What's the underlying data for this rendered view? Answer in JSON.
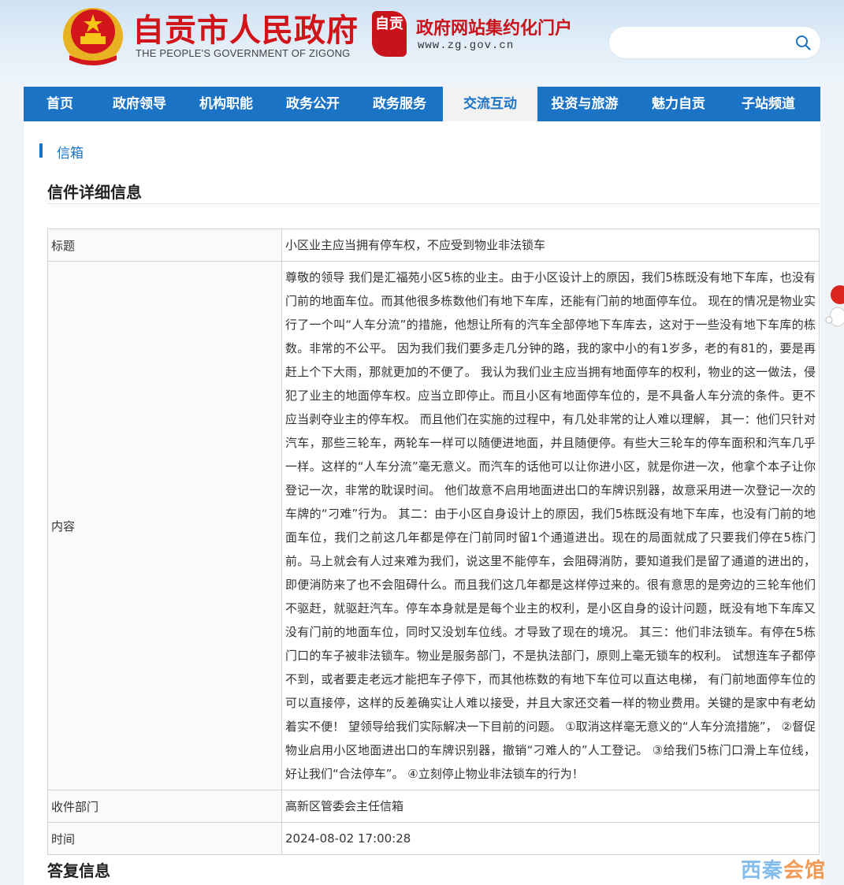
{
  "header": {
    "site_title": "自贡市人民政府",
    "site_subtitle": "THE PEOPLE'S GOVERNMENT OF ZIGONG",
    "portal_logo_text": "自贡",
    "portal_title": "政府网站集约化门户",
    "portal_url": "www.zg.gov.cn",
    "search_placeholder": ""
  },
  "nav": {
    "items": [
      {
        "label": "首页",
        "width": 92
      },
      {
        "label": "政府领导",
        "width": 110
      },
      {
        "label": "机构职能",
        "width": 110
      },
      {
        "label": "政务公开",
        "width": 110
      },
      {
        "label": "政务服务",
        "width": 110
      },
      {
        "label": "交流互动",
        "width": 120,
        "active": true
      },
      {
        "label": "投资与旅游",
        "width": 120
      },
      {
        "label": "魅力自贡",
        "width": 118
      },
      {
        "label": "子站频道",
        "width": 110
      }
    ]
  },
  "breadcrumb": "信箱",
  "section_title": "信件详细信息",
  "letter": {
    "title_label": "标题",
    "title_value": "小区业主应当拥有停车权，不应受到物业非法锁车",
    "content_label": "内容",
    "content_value": "尊敬的领导 我们是汇福苑小区5栋的业主。由于小区设计上的原因，我们5栋既没有地下车库，也没有门前的地面车位。而其他很多栋数他们有地下车库，还能有门前的地面停车位。 现在的情况是物业实行了一个叫“人车分流”的措施，他想让所有的汽车全部停地下车库去，这对于一些没有地下车库的栋数。非常的不公平。 因为我们我们要多走几分钟的路，我的家中小的有1岁多，老的有81的，要是再赶上个下大雨，那就更加的不便了。 我认为我们业主应当拥有地面停车的权利，物业的这一做法，侵犯了业主的地面停车权。应当立即停止。而且小区有地面停车位的，是不具备人车分流的条件。更不应当剥夺业主的停车权。 而且他们在实施的过程中，有几处非常的让人难以理解， 其一：他们只针对汽车，那些三轮车，两轮车一样可以随便进地面，并且随便停。有些大三轮车的停车面积和汽车几乎一样。这样的“人车分流”毫无意义。而汽车的话他可以让你进小区，就是你进一次，他拿个本子让你登记一次，非常的耽误时间。 他们故意不启用地面进出口的车牌识别器，故意采用进一次登记一次的车牌的“刁难”行为。 其二：由于小区自身设计上的原因，我们5栋既没有地下车库，也没有门前的地面车位，我们之前这几年都是停在门前同时留1个通道进出。现在的局面就成了只要我们停在5栋门前。马上就会有人过来难为我们，说这里不能停车，会阻碍消防，要知道我们是留了通道的进出的，即便消防来了也不会阻碍什么。而且我们这几年都是这样停过来的。很有意思的是旁边的三轮车他们不驱赶，就驱赶汽车。停车本身就是是每个业主的权利，是小区自身的设计问题，既没有地下车库又没有门前的地面车位，同时又没划车位线。才导致了现在的境况。 其三：他们非法锁车。有停在5栋门口的车子被非法锁车。物业是服务部门，不是执法部门，原则上毫无锁车的权利。 试想连车子都停不到，或者要走老远才能把车子停下，而其他栋数的有地下车位可以直达电梯， 有门前地面停车位的可以直接停，这样的反差确实让人难以接受，并且大家还交着一样的物业费用。关键的是家中有老幼着实不便！ 望领导给我们实际解决一下目前的问题。 ①取消这样毫无意义的“人车分流措施”， ②督促物业启用小区地面进出口的车牌识别器，撤销“刁难人的”人工登记。 ③给我们5栋门口滑上车位线，好让我们“合法停车”。 ④立刻停止物业非法锁车的行为！",
    "dept_label": "收件部门",
    "dept_value": "高新区管委会主任信箱",
    "time_label": "时间",
    "time_value": "2024-08-02 17:00:28"
  },
  "reply_title": "答复信息",
  "watermark_a": "西秦",
  "watermark_b": "会馆",
  "colors": {
    "nav_blue": "#1a73c5",
    "brand_red": "#d0141a"
  }
}
